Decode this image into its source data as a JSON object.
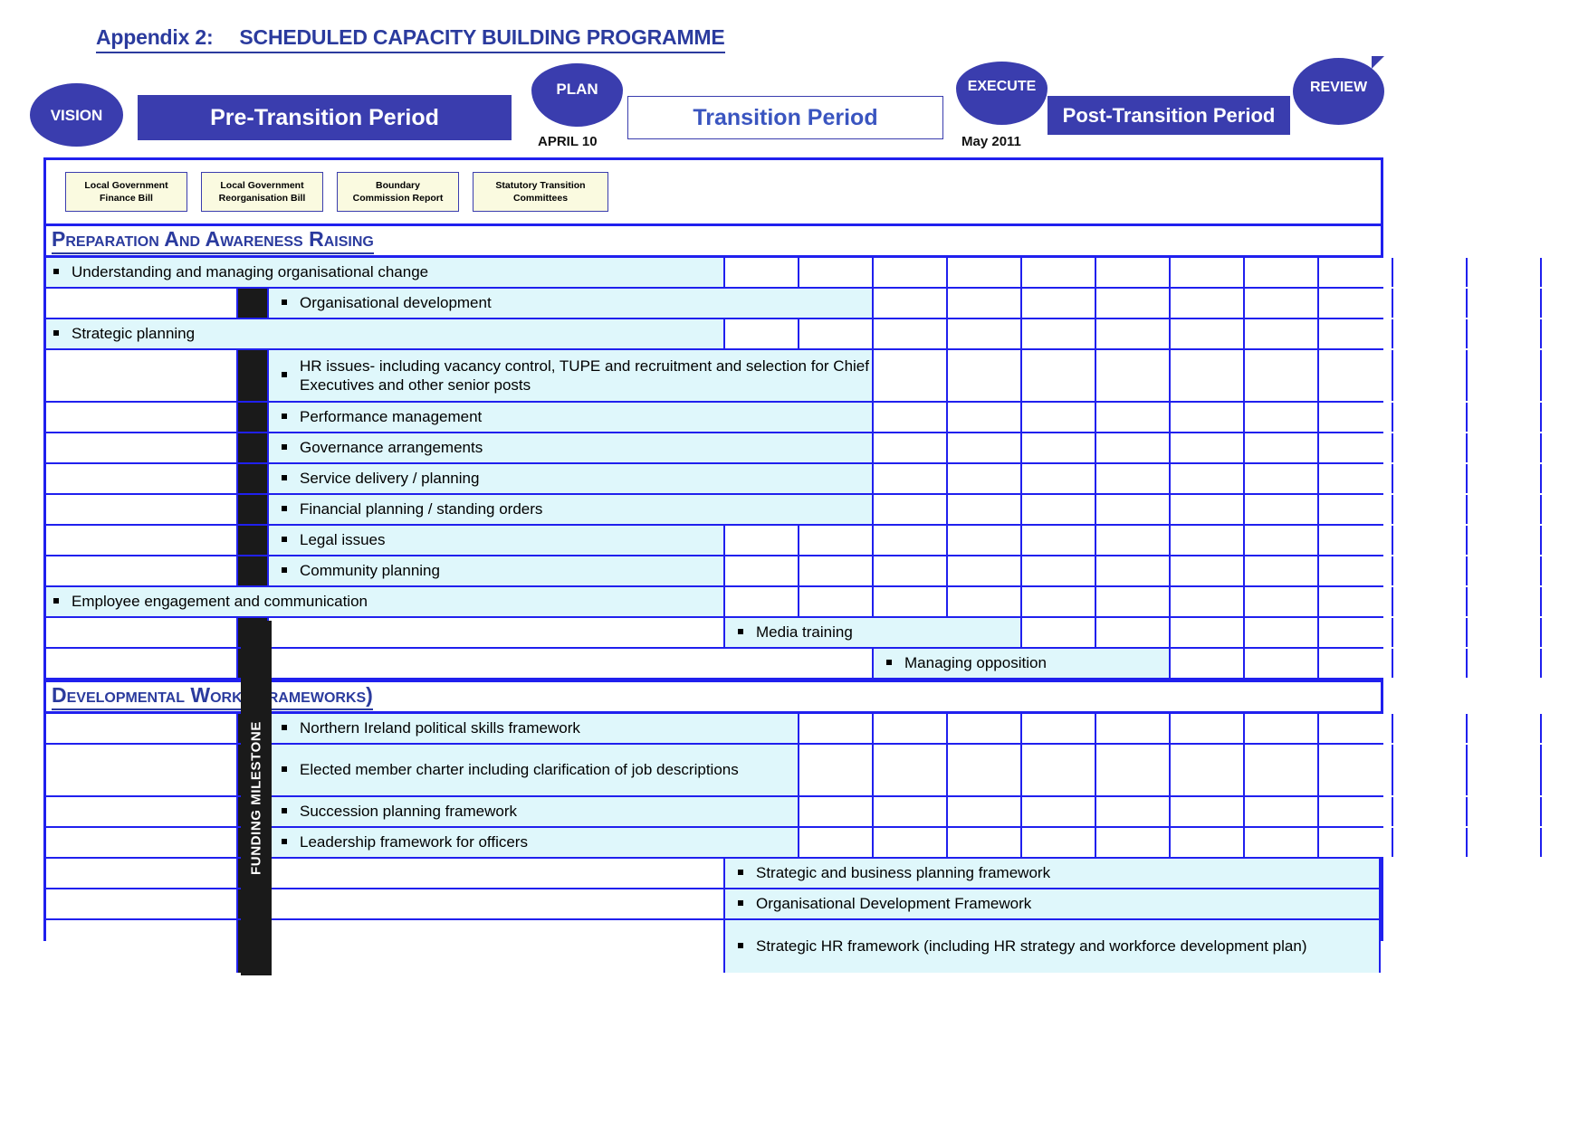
{
  "document": {
    "title_prefix": "Appendix 2:",
    "title_main": "SCHEDULED CAPACITY BUILDING PROGRAMME",
    "title_full": "Appendix 2:  SCHEDULED CAPACITY BUILDING PROGRAMME"
  },
  "timeline": {
    "badges": {
      "vision": "VISION",
      "plan": "PLAN",
      "execute": "EXECUTE",
      "review": "REVIEW"
    },
    "bars": {
      "pre_transition": "Pre-Transition Period",
      "transition": "Transition Period",
      "post_transition": "Post-Transition Period"
    },
    "dates": {
      "plan_date": "APRIL 10",
      "execute_date": "May 2011"
    },
    "accent_color": "#3A3DAE",
    "grid_color": "#2020EE",
    "tint_color": "#DFF7FB",
    "bill_color": "#FAFAE0",
    "milestone_color": "#1A1A1A"
  },
  "bills": [
    {
      "line1": "Local Government",
      "line2": "Finance Bill"
    },
    {
      "line1": "Local Government",
      "line2": "Reorganisation Bill"
    },
    {
      "line1": "Boundary",
      "line2": "Commission Report"
    },
    {
      "line1": "Statutory Transition",
      "line2": "Committees"
    }
  ],
  "milestone_label": "FUNDING MILESTONE",
  "sections": [
    {
      "heading": "Preparation and Awareness raising",
      "rows": [
        {
          "label": "Understanding and managing organisational change",
          "indent": 0,
          "milestone": false,
          "start": 0,
          "span": 6
        },
        {
          "label": "Organisational development",
          "indent": 1,
          "milestone": true,
          "start": 2,
          "span": 6
        },
        {
          "label": "Strategic planning",
          "indent": 0,
          "milestone": false,
          "start": 0,
          "span": 6
        },
        {
          "label": "HR issues- including vacancy control, TUPE and recruitment and selection for Chief Executives and other senior posts",
          "indent": 1,
          "milestone": true,
          "start": 2,
          "span": 6
        },
        {
          "label": "Performance management",
          "indent": 1,
          "milestone": true,
          "start": 2,
          "span": 6
        },
        {
          "label": "Governance arrangements",
          "indent": 1,
          "milestone": true,
          "start": 2,
          "span": 6
        },
        {
          "label": "Service delivery / planning",
          "indent": 1,
          "milestone": true,
          "start": 2,
          "span": 6
        },
        {
          "label": "Financial planning / standing orders",
          "indent": 1,
          "milestone": true,
          "start": 2,
          "span": 6
        },
        {
          "label": "Legal issues",
          "indent": 1,
          "milestone": true,
          "start": 2,
          "span": 4
        },
        {
          "label": "Community planning",
          "indent": 1,
          "milestone": true,
          "start": 2,
          "span": 4
        },
        {
          "label": "Employee engagement and communication",
          "indent": 0,
          "milestone": false,
          "start": 0,
          "span": 6
        },
        {
          "label": "Media training",
          "indent": 1,
          "milestone": true,
          "start": 6,
          "span": 4
        },
        {
          "label": "Managing opposition",
          "indent": 1,
          "milestone": true,
          "start": 8,
          "span": 4
        }
      ]
    },
    {
      "heading": "Developmental work (Frameworks)",
      "rows": [
        {
          "label": "Northern Ireland political skills framework",
          "indent": 1,
          "milestone": true,
          "start": 2,
          "span": 5
        },
        {
          "label": "Elected member charter including clarification of job descriptions",
          "indent": 1,
          "milestone": true,
          "start": 2,
          "span": 5
        },
        {
          "label": "Succession planning framework",
          "indent": 1,
          "milestone": true,
          "start": 2,
          "span": 5
        },
        {
          "label": "Leadership framework for officers",
          "indent": 1,
          "milestone": true,
          "start": 2,
          "span": 5
        },
        {
          "label": "Strategic and business planning framework",
          "indent": 1,
          "milestone": true,
          "start": 6,
          "span": 12
        },
        {
          "label": "Organisational Development Framework",
          "indent": 1,
          "milestone": true,
          "start": 6,
          "span": 12
        },
        {
          "label": "Strategic HR framework (including HR strategy and workforce development plan)",
          "indent": 1,
          "milestone": true,
          "start": 6,
          "span": 12
        }
      ]
    }
  ]
}
